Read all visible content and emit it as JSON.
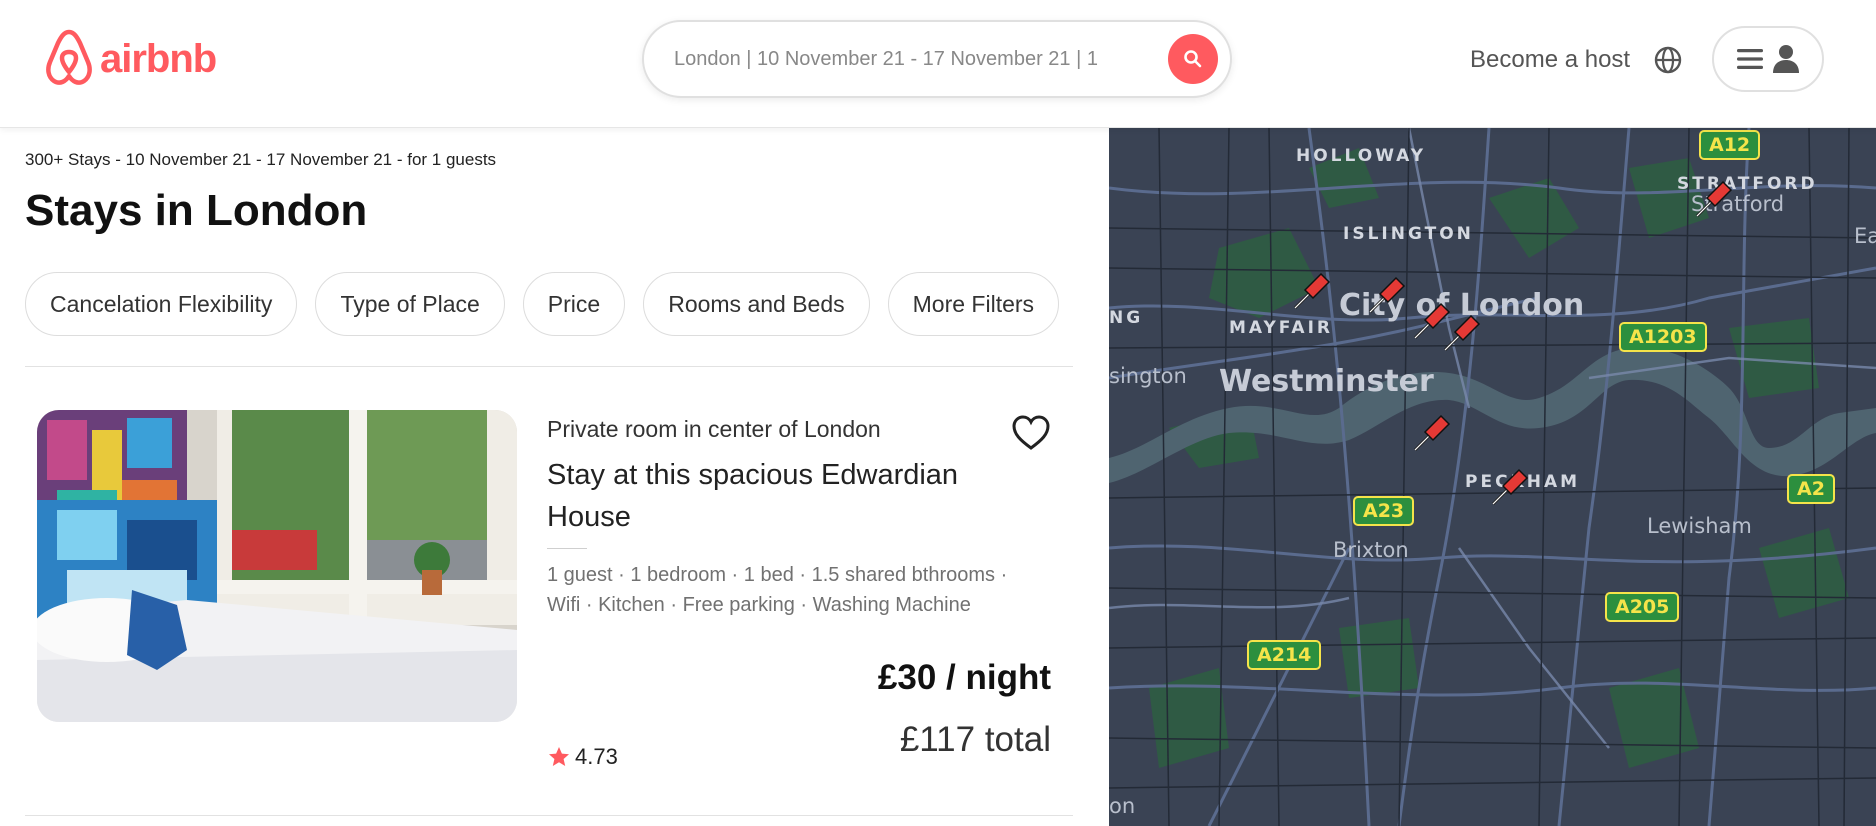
{
  "header": {
    "logo_text": "airbnb",
    "brand_color": "#ff5a5f",
    "search_text": "London | 10 November 21 - 17 November 21 | 1",
    "search_icon": "search-icon",
    "become_host": "Become a host",
    "globe_icon": "globe-icon",
    "menu_icon": "hamburger-menu-icon",
    "user_icon": "user-icon"
  },
  "results": {
    "meta": "300+ Stays - 10 November 21 - 17 November 21 - for 1 guests",
    "title": "Stays in London",
    "filters": [
      "Cancelation Flexibility",
      "Type of Place",
      "Price",
      "Rooms and Beds",
      "More Filters"
    ]
  },
  "listings": [
    {
      "type": "Private room in center of London",
      "title": "Stay at this spacious Edwardian House",
      "features_line1": "1 guest · 1 bedroom · 1 bed · 1.5 shared bthrooms ·",
      "features_line2": "Wifi · Kitchen · Free parking · Washing Machine",
      "price": "£30 / night",
      "total": "£117 total",
      "rating": "4.73",
      "favorite_icon": "heart-icon",
      "rating_icon": "star-icon"
    }
  ],
  "map": {
    "areas_small": [
      "HOLLOWAY",
      "ISLINGTON",
      "STRATFORD",
      "MAYFAIR",
      "NG",
      "PECKHAM"
    ],
    "areas_large": [
      "City of London",
      "Westminster"
    ],
    "areas_mid": [
      "Stratford",
      "Lewisham",
      "Brixton",
      "sington",
      "Ea",
      "on"
    ],
    "roads": [
      "A12",
      "A1203",
      "A2",
      "A23",
      "A205",
      "A214"
    ],
    "pin_count": 7,
    "pin_icon": "pushpin-icon"
  }
}
